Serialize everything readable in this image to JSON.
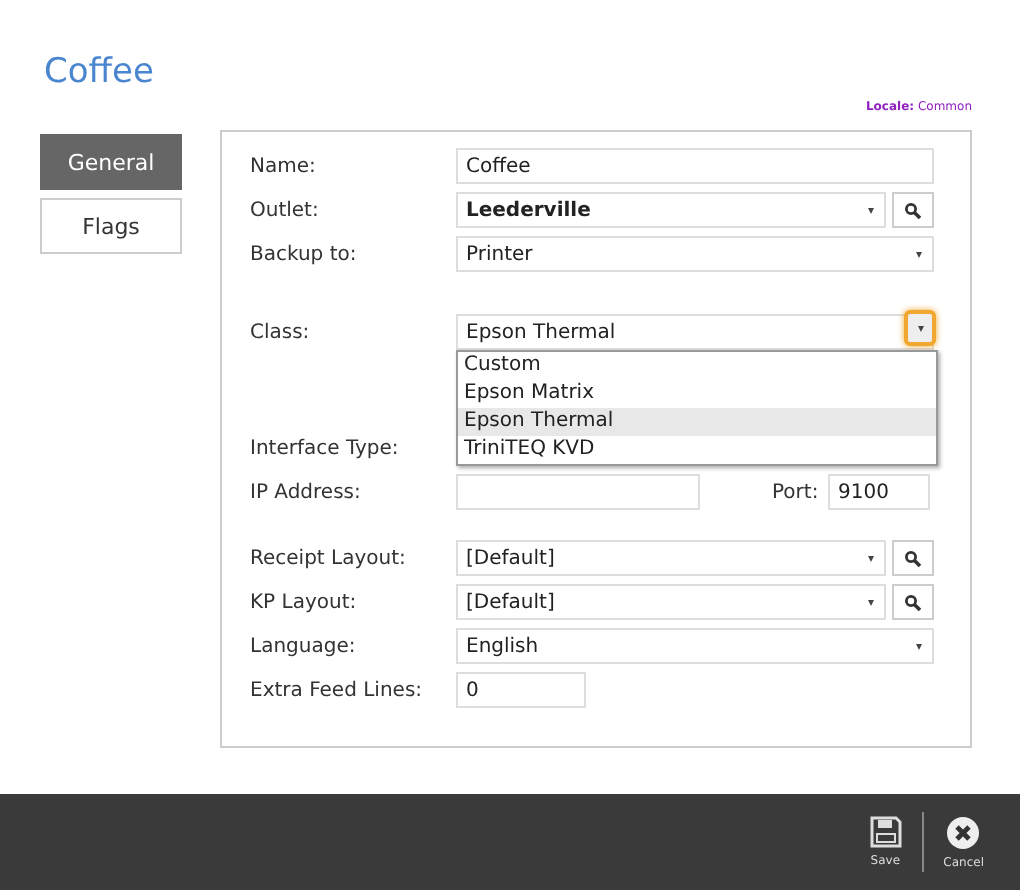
{
  "title": "Coffee",
  "locale": {
    "label": "Locale:",
    "value": "Common"
  },
  "tabs": [
    {
      "label": "General",
      "selected": true
    },
    {
      "label": "Flags",
      "selected": false
    }
  ],
  "form": {
    "groups": [
      [
        {
          "label": "Name:",
          "kind": "text",
          "value": "Coffee"
        },
        {
          "label": "Outlet:",
          "kind": "select",
          "value": "Leederville",
          "bold": true,
          "search": true
        },
        {
          "label": "Backup to:",
          "kind": "select",
          "value": "Printer"
        }
      ],
      [
        {
          "label": "Class:",
          "kind": "select",
          "value": "Epson Thermal",
          "expanded": true,
          "options": [
            {
              "label": "Custom",
              "selected": false
            },
            {
              "label": "Epson Matrix",
              "selected": false
            },
            {
              "label": "Epson Thermal",
              "selected": true
            },
            {
              "label": "TriniTEQ KVD",
              "selected": false
            }
          ]
        },
        {
          "label": "Interface Type:",
          "kind": "hidden"
        },
        {
          "label": "IP Address:",
          "kind": "ip",
          "port_label": "Port:",
          "port_value": "9100"
        }
      ],
      [
        {
          "label": "Receipt Layout:",
          "kind": "select",
          "value": "[Default]",
          "search": true
        },
        {
          "label": "KP Layout:",
          "kind": "select",
          "value": "[Default]",
          "search": true
        },
        {
          "label": "Language:",
          "kind": "select",
          "value": "English"
        },
        {
          "label": "Extra Feed Lines:",
          "kind": "short",
          "value": "0"
        }
      ]
    ]
  },
  "footer": [
    {
      "kind": "save",
      "label": "Save"
    },
    {
      "kind": "cancel",
      "label": "Cancel"
    }
  ]
}
